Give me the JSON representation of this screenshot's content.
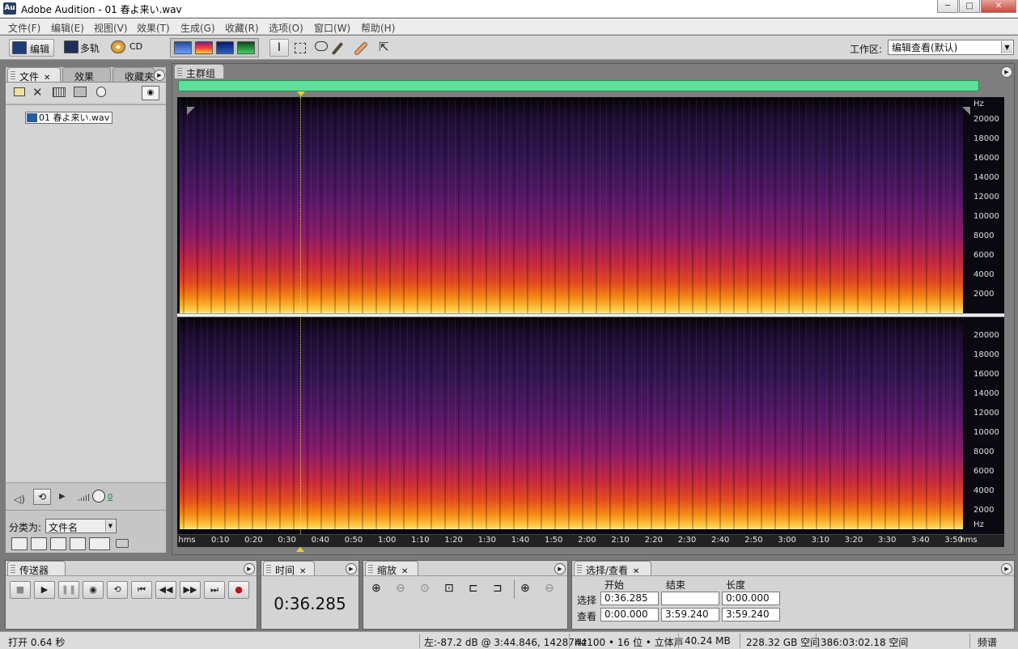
{
  "window": {
    "app_icon": "Au",
    "title": "Adobe Audition - 01 春よ来い.wav",
    "controls": [
      "─",
      "□",
      "✕"
    ]
  },
  "menu": [
    "文件(F)",
    "编辑(E)",
    "视图(V)",
    "效果(T)",
    "生成(G)",
    "收藏(R)",
    "选项(O)",
    "窗口(W)",
    "帮助(H)"
  ],
  "toolbar": {
    "edit_label": "编辑",
    "multitrack_label": "多轨",
    "cd_label": "CD",
    "workspace_label": "工作区:",
    "workspace_value": "编辑查看(默认)",
    "view_mode_icons": [
      "waveform-view-icon",
      "spectral-view-icon",
      "pan-view-icon",
      "phase-view-icon"
    ],
    "tool_icons": [
      "time-selection-icon",
      "marquee-icon",
      "lasso-icon",
      "brush-icon",
      "spot-healing-icon",
      "hybrid-tool-icon"
    ]
  },
  "files_panel": {
    "tabs": [
      "文件",
      "效果",
      "收藏夹"
    ],
    "file_item": "01 春よ来い.wav",
    "sort_label": "分类为:",
    "sort_value": "文件名",
    "volume_value": "0"
  },
  "main_group": {
    "tab_label": "主群组",
    "hz_labels_top": [
      "Hz",
      "20000",
      "18000",
      "16000",
      "14000",
      "12000",
      "10000",
      "8000",
      "6000",
      "4000",
      "2000"
    ],
    "hz_labels_bottom": [
      "20000",
      "18000",
      "16000",
      "14000",
      "12000",
      "10000",
      "8000",
      "6000",
      "4000",
      "2000",
      "Hz"
    ],
    "time_labels": [
      "hms",
      "0:10",
      "0:20",
      "0:30",
      "0:40",
      "0:50",
      "1:00",
      "1:10",
      "1:20",
      "1:30",
      "1:40",
      "1:50",
      "2:00",
      "2:10",
      "2:20",
      "2:30",
      "2:40",
      "2:50",
      "3:00",
      "3:10",
      "3:20",
      "3:30",
      "3:40",
      "3:50",
      "hms"
    ],
    "playhead_seconds": 36.285,
    "duration_seconds": 239.24
  },
  "transport_panel": {
    "tab_label": "传送器"
  },
  "time_panel": {
    "tab_label": "时间",
    "time_display": "0:36.285"
  },
  "zoom_panel": {
    "tab_label": "缩放"
  },
  "selection_panel": {
    "tab_label": "选择/查看",
    "col_start": "开始",
    "col_end": "结束",
    "col_length": "长度",
    "row_selection": "选择",
    "row_view": "查看",
    "selection_start": "0:36.285",
    "selection_end": "",
    "selection_length": "0:00.000",
    "view_start": "0:00.000",
    "view_end": "3:59.240",
    "view_length": "3:59.240"
  },
  "status": {
    "open_time": "打开 0.64 秒",
    "level_info": "左:-87.2 dB @  3:44.846, 14287Hz",
    "format": "44100 • 16 位 • 立体声",
    "file_size": "40.24 MB",
    "disk_free": "228.32 GB 空间",
    "time_free": "386:03:02.18 空间",
    "view_mode": "频谱"
  }
}
